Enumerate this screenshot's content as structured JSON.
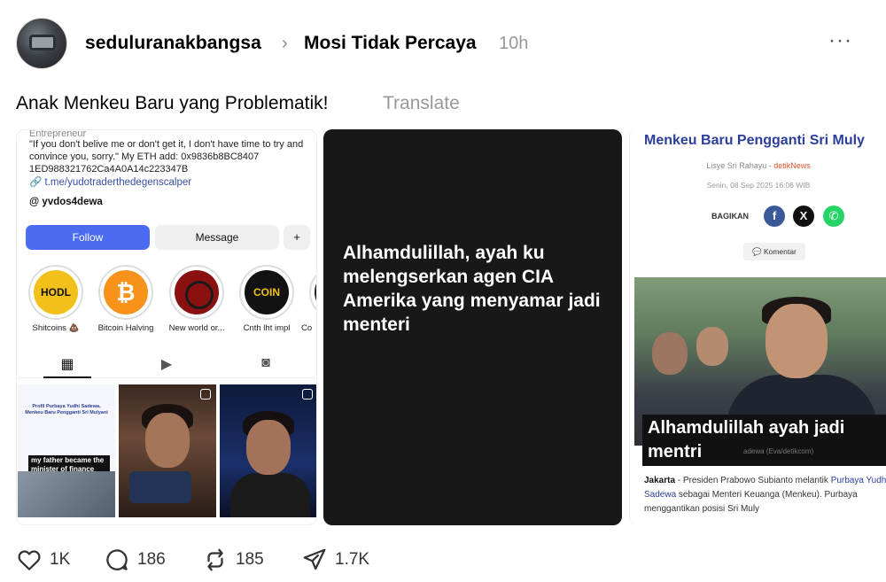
{
  "post": {
    "username": "seduluranakbangsa",
    "community": "Mosi Tidak Percaya",
    "time": "10h",
    "more": "···",
    "caption": "Anak Menkeu Baru yang Problematik!",
    "translate": "Translate"
  },
  "panel1": {
    "role": "Entrepreneur",
    "bio": "\"If you don't belive me or don't get it, I don't have time to try and convince you, sorry.\" My ETH add: 0x9836b8BC8407 1ED988321762Ca4A0A14c223347B",
    "link": "t.me/yudotraderthedegenscalper",
    "threads": "yvdos4dewa",
    "follow_label": "Follow",
    "message_label": "Message",
    "add_user": "+",
    "highlights": [
      {
        "label": "Shitcoins 💩",
        "inner": "HODL"
      },
      {
        "label": "Bitcoin Halving",
        "inner": "₿"
      },
      {
        "label": "New world or...",
        "inner": ""
      },
      {
        "label": "Cnth lht impl",
        "inner": "COIN"
      },
      {
        "label": "Co",
        "inner": ""
      }
    ],
    "thumb1_headline": "Profil Purbaya Yudhi Sadewa, Menkeu Baru Pengganti Sri Mulyani",
    "thumb1_overlay": "my father became the minister of finance"
  },
  "panel2": {
    "text": "Alhamdulillah, ayah ku melengserkan agen CIA Amerika yang menyamar jadi menteri"
  },
  "panel3": {
    "title": "Menkeu Baru Pengganti Sri Muly",
    "author": "Lisye Sri Rahayu",
    "source": "detikNews",
    "date": "Senin, 08 Sep 2025 16:06 WIB",
    "share_label": "BAGIKAN",
    "comment_label": "Komentar",
    "overlay": "Alhamdulillah ayah jadi mentri",
    "credit": "adewa (Eva/detikcom)",
    "body_loc": "Jakarta",
    "body_1": " - Presiden Prabowo Subianto melantik ",
    "body_link": "Purbaya Yudhi Sadewa",
    "body_2": " sebagai Menteri Keuanga (Menkeu). Purbaya menggantikan posisi Sri Muly"
  },
  "actions": {
    "likes": "1K",
    "replies": "186",
    "reposts": "185",
    "shares": "1.7K"
  }
}
